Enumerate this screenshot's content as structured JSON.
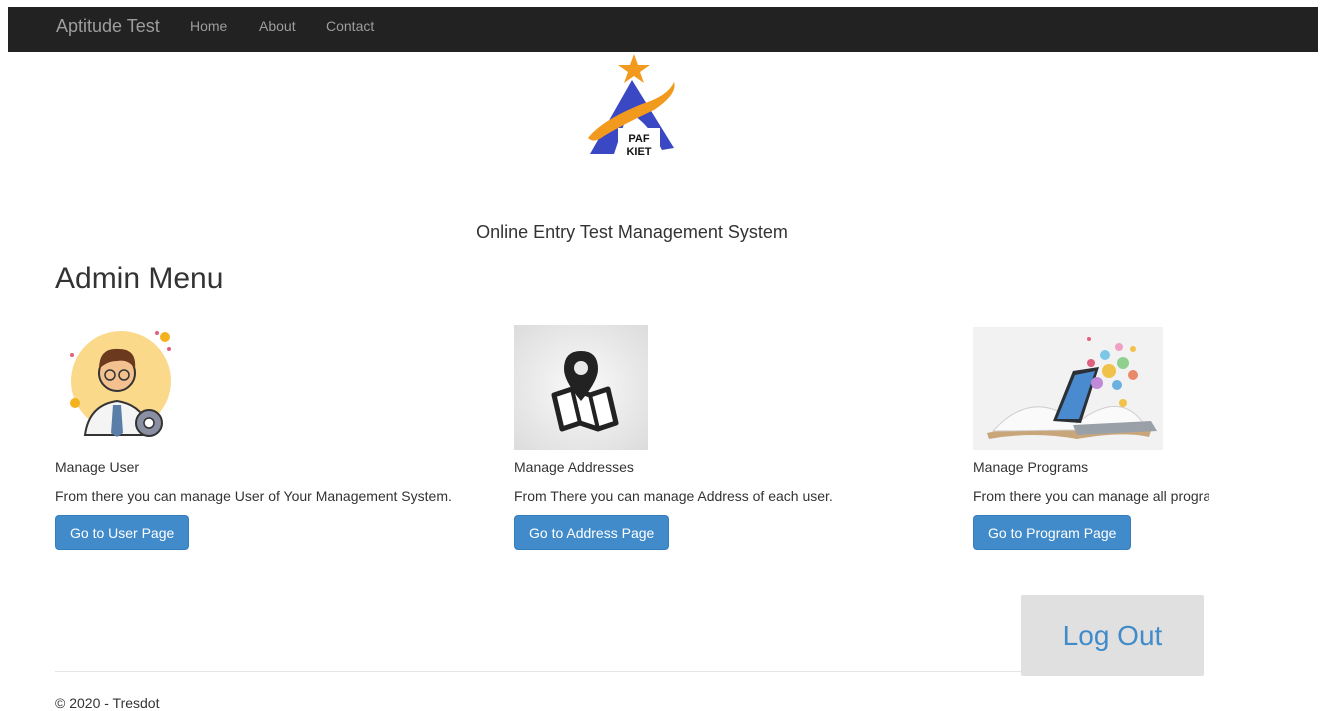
{
  "nav": {
    "brand": "Aptitude Test",
    "links": [
      "Home",
      "About",
      "Contact"
    ]
  },
  "logo": {
    "text_top": "PAF",
    "text_bottom": "KIET"
  },
  "subtitle": "Online Entry Test Management System",
  "heading": "Admin Menu",
  "cards": [
    {
      "title": "Manage User",
      "description": "From there you can manage User of Your Management System.",
      "button": "Go to User Page",
      "image_icon": "user-admin-illustration"
    },
    {
      "title": "Manage Addresses",
      "description": "From There you can manage Address of each user.",
      "button": "Go to Address Page",
      "image_icon": "map-pin-illustration"
    },
    {
      "title": "Manage Programs",
      "description": "From there you can manage all progra",
      "button": "Go to Program Page",
      "image_icon": "laptop-book-illustration"
    }
  ],
  "logout": "Log Out",
  "footer": "© 2020 - Tresdot",
  "colors": {
    "navbar": "#222222",
    "nav_text": "#9d9d9d",
    "button": "#428bca",
    "logout_bg": "#e0e0e0"
  }
}
